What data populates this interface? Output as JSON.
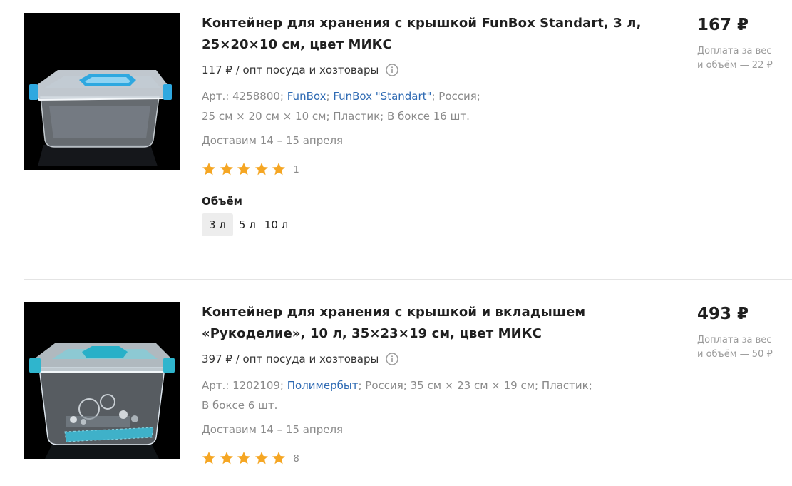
{
  "products": [
    {
      "image_alt": "container-funbox-standart",
      "title_line1": "Контейнер для хранения с крышкой FunBox Standart, 3 л,",
      "title_line2": "25×20×10 см, цвет МИКС",
      "wholesale": "117 ₽ / опт посуда и хозтовары",
      "specs": {
        "art": "Арт.: 4258800;",
        "brand1": "FunBox",
        "sep1": ";",
        "brand2": "FunBox \"Standart\"",
        "rest1": "; Россия;",
        "rest2": "25 см × 20 см × 10 см; Пластик; В боксе 16 шт."
      },
      "delivery": "Доставим 14 – 15 апреля",
      "rating": 5,
      "reviews": "1",
      "variant_label": "Объём",
      "variants": [
        "3 л",
        "5 л",
        "10 л"
      ],
      "selected_variant": "3 л",
      "price": "167 ₽",
      "surcharge_line1": "Доплата за вес",
      "surcharge_line2": "и объём — 22 ₽"
    },
    {
      "image_alt": "container-rukodelie",
      "title_line1": "Контейнер для хранения с крышкой и вкладышем",
      "title_line2": "«Рукоделие», 10 л, 35×23×19 см, цвет МИКС",
      "wholesale": "397 ₽ / опт посуда и хозтовары",
      "specs": {
        "art": "Арт.: 1202109;",
        "brand1": "Полимербыт",
        "rest1": "; Россия; 35 см × 23 см × 19 см; Пластик;",
        "rest2": "В боксе 6 шт."
      },
      "delivery": "Доставим 14 – 15 апреля",
      "rating": 5,
      "reviews": "8",
      "price": "493 ₽",
      "surcharge_line1": "Доплата за вес",
      "surcharge_line2": "и объём — 50 ₽"
    }
  ],
  "colors": {
    "link": "#2e6ab3",
    "star": "#f5a623",
    "muted": "#8a8a8a",
    "text": "#1f1f1f"
  },
  "icons": [
    "info-icon",
    "star-icon"
  ]
}
